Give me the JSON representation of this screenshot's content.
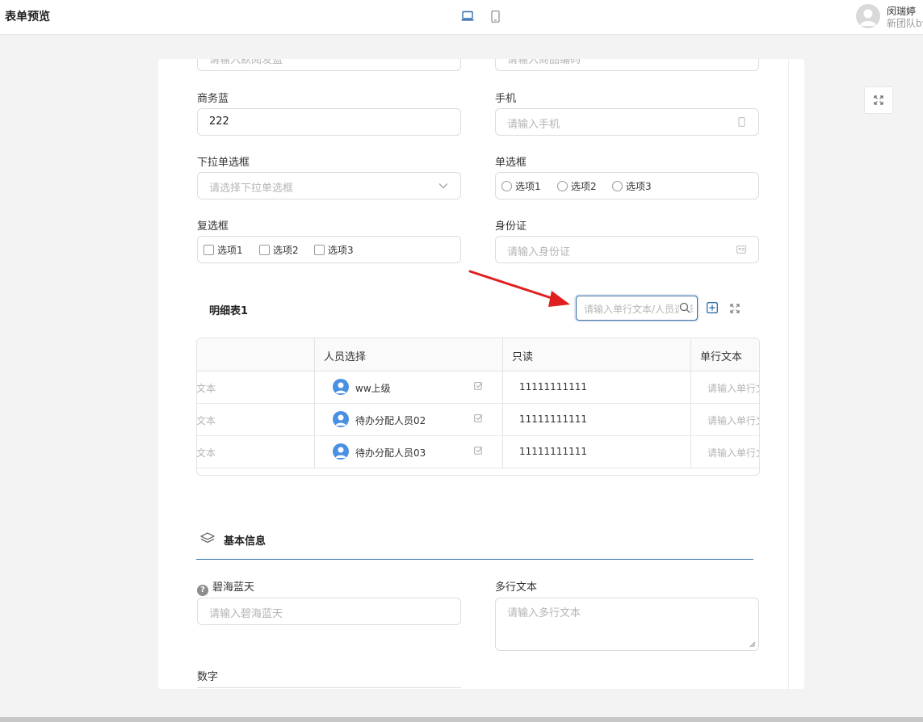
{
  "header": {
    "title": "表单预览",
    "user_name": "闵瑞婷",
    "user_team": "新团队by"
  },
  "form_top": {
    "partial_left_placeholder": "请输入默阅发蓝",
    "partial_right_placeholder": "请输入商品编码"
  },
  "fields": {
    "business_blue": {
      "label": "商务蓝",
      "value": "222"
    },
    "mobile": {
      "label": "手机",
      "placeholder": "请输入手机",
      "icon": "mobile-icon"
    },
    "select": {
      "label": "下拉单选框",
      "placeholder": "请选择下拉单选框",
      "icon": "chevron-down-icon"
    },
    "radio": {
      "label": "单选框",
      "options": [
        "选项1",
        "选项2",
        "选项3"
      ]
    },
    "checkbox": {
      "label": "复选框",
      "options": [
        "选项1",
        "选项2",
        "选项3"
      ]
    },
    "id_card": {
      "label": "身份证",
      "placeholder": "请输入身份证",
      "icon": "id-card-icon"
    }
  },
  "detail_table": {
    "title": "明细表1",
    "search_placeholder": "请输入单行文本/人员选择",
    "columns": [
      "人员选择",
      "只读",
      "单行文本"
    ],
    "rows": [
      {
        "text": "文本",
        "person": "ww上级",
        "readonly": "11111111111",
        "single": "请输入单行文本"
      },
      {
        "text": "文本",
        "person": "待办分配人员02",
        "readonly": "11111111111",
        "single": "请输入单行文本"
      },
      {
        "text": "文本",
        "person": "待办分配人员03",
        "readonly": "11111111111",
        "single": "请输入单行文本"
      }
    ]
  },
  "basic_info": {
    "title": "基本信息",
    "sky_label": "碧海蓝天",
    "sky_placeholder": "请输入碧海蓝天",
    "multiline_label": "多行文本",
    "multiline_placeholder": "请输入多行文本",
    "number_label": "数字"
  },
  "colors": {
    "accent": "#2f6ea8",
    "arrow": "#e02020",
    "person_icon": "#4a90e2"
  }
}
